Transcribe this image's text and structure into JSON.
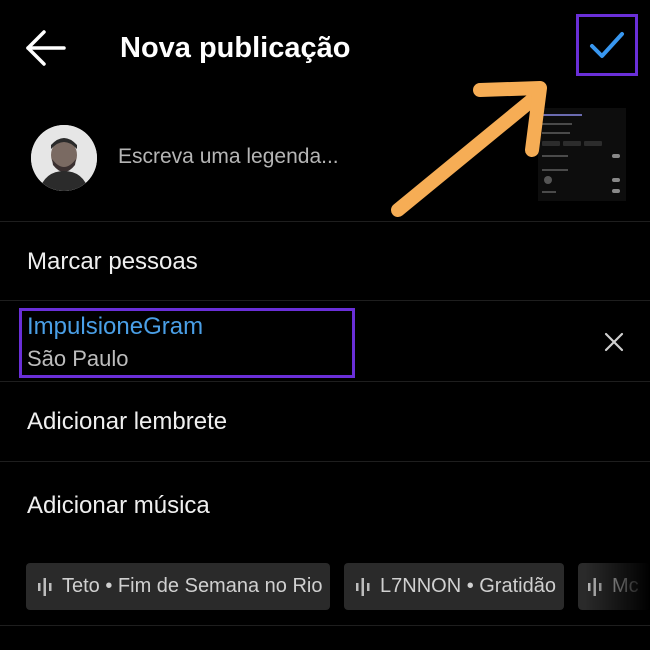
{
  "header": {
    "title": "Nova publicação",
    "back_icon": "arrow-left-icon",
    "confirm_icon": "checkmark-icon",
    "accent_color": "#3897f0",
    "highlight_color": "#6a2fd8"
  },
  "caption": {
    "placeholder": "Escreva uma legenda..."
  },
  "annotation": {
    "arrow_color": "#f6ad55"
  },
  "options": {
    "tag_people": "Marcar pessoas",
    "location_name": "ImpulsioneGram",
    "location_city": "São Paulo",
    "add_reminder": "Adicionar lembrete",
    "add_music": "Adicionar música"
  },
  "music": {
    "suggestions": [
      {
        "label": "Teto • Fim de Semana no Rio"
      },
      {
        "label": "L7NNON • Gratidão"
      },
      {
        "label": "Mc"
      }
    ]
  }
}
